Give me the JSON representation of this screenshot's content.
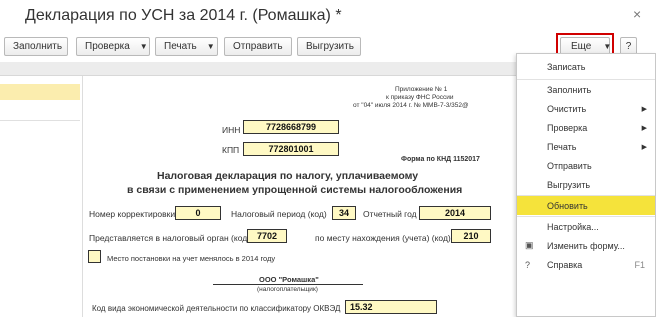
{
  "window": {
    "title": "Декларация по УСН за 2014 г. (Ромашка) *",
    "close_glyph": "×"
  },
  "toolbar": {
    "fill": "Заполнить",
    "check": "Проверка",
    "print": "Печать",
    "send": "Отправить",
    "upload": "Выгрузить",
    "more": "Еще",
    "help": "?"
  },
  "document": {
    "appendix_line1": "Приложение № 1",
    "appendix_line2": "к приказу ФНС России",
    "appendix_line3": "от \"04\" июля 2014 г. № ММВ-7-3/352@",
    "inn_label": "ИНН",
    "inn_value": "7728668799",
    "kpp_label": "КПП",
    "kpp_value": "772801001",
    "knd_form": "Форма по КНД 1152017",
    "heading_line1": "Налоговая декларация по налогу, уплачиваемому",
    "heading_line2": "в связи с применением упрощенной системы налогообложения",
    "correction_label": "Номер корректировки",
    "correction_value": "0",
    "period_label": "Налоговый период (код)",
    "period_value": "34",
    "year_label": "Отчетный год",
    "year_value": "2014",
    "authority_label": "Представляется в налоговый орган (код)",
    "authority_value": "7702",
    "location_label": "по месту нахождения (учета) (код)",
    "location_value": "210",
    "registration_change_label": "Место постановки на учет менялось в 2014 году",
    "org_name": "ООО \"Ромашка\"",
    "org_caption": "(налогоплательщик)",
    "okved_label": "Код вида экономической деятельности по классификатору ОКВЭД",
    "okved_value": "15.32"
  },
  "menu": {
    "items": [
      {
        "label": "Записать"
      },
      {
        "label": "Заполнить"
      },
      {
        "label": "Очистить"
      },
      {
        "label": "Проверка"
      },
      {
        "label": "Печать"
      },
      {
        "label": "Отправить"
      },
      {
        "label": "Выгрузить"
      },
      {
        "label": "Обновить"
      },
      {
        "label": "Настройка..."
      },
      {
        "label": "Изменить форму..."
      },
      {
        "label": "Справка",
        "shortcut": "F1"
      }
    ],
    "highlight_color": "#f5e33b"
  },
  "colors": {
    "field_fill": "#fff9c4",
    "more_button_outline": "#d00000",
    "left_selection": "#fbedae"
  }
}
